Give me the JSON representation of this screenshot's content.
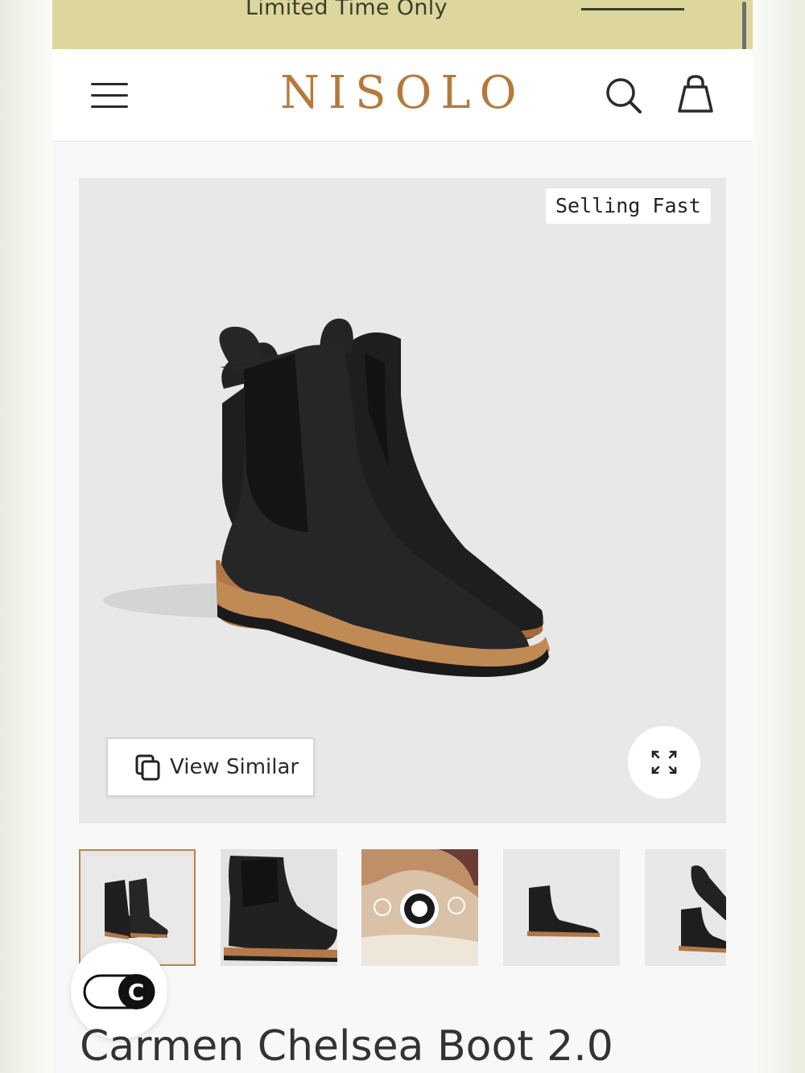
{
  "promo": {
    "text": "Limited Time Only"
  },
  "header": {
    "logo": "NISOLO",
    "icons": [
      "menu-icon",
      "search-icon",
      "bag-icon"
    ]
  },
  "product": {
    "badge": "Selling Fast",
    "view_similar_label": "View Similar",
    "title": "Carmen Chelsea Boot 2.0",
    "thumbnails": [
      {
        "name": "boot-pair-front",
        "selected": true
      },
      {
        "name": "boot-side-closeup",
        "selected": false
      },
      {
        "name": "leather-working-group-certified",
        "selected": false
      },
      {
        "name": "boot-single-side",
        "selected": false
      },
      {
        "name": "boots-top-view",
        "selected": false
      }
    ]
  },
  "colors": {
    "promo_bg": "#ddd79e",
    "logo": "#b57a3b",
    "thumb_selected_border": "#b8834c",
    "title_text": "#333333"
  }
}
